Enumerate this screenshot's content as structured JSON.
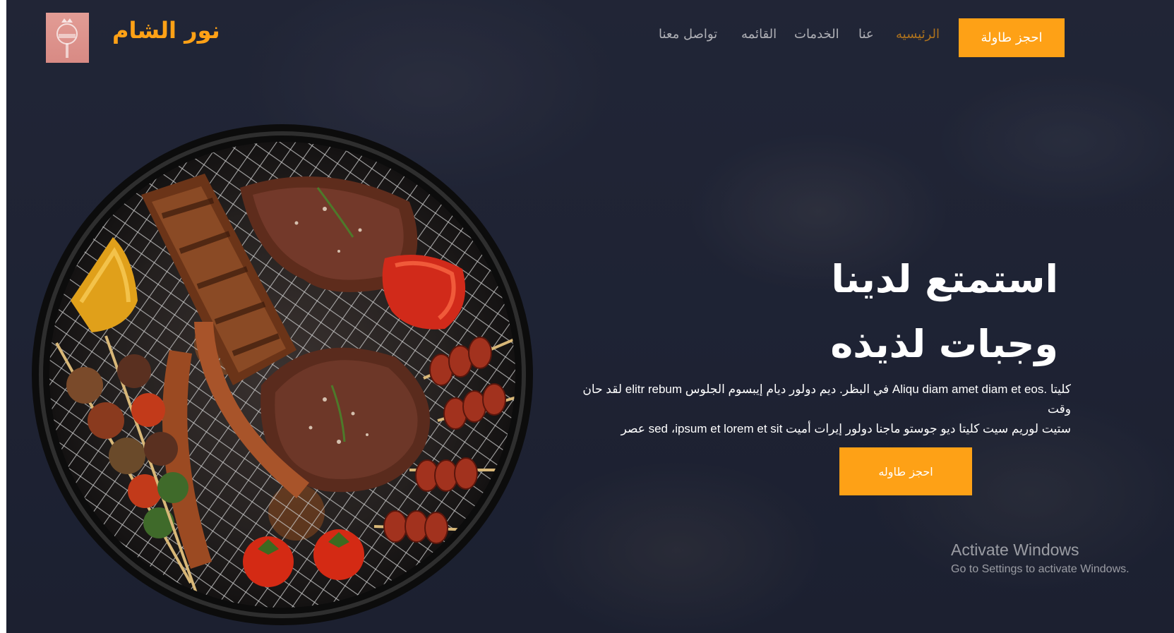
{
  "colors": {
    "accent": "#fea116",
    "background": "#232839",
    "text": "#ffffff"
  },
  "navbar": {
    "brand": "نور الشام",
    "logo_icon": "restaurant-logo-icon",
    "links": [
      {
        "label": "الرئيسيه",
        "active": true
      },
      {
        "label": "عنا",
        "active": false
      },
      {
        "label": "الخدمات",
        "active": false
      },
      {
        "label": "القائمه",
        "active": false
      },
      {
        "label": "تواصل معنا",
        "active": false
      }
    ],
    "book_button": "احجز طاولة"
  },
  "hero": {
    "title_line1": "استمتع لدينا",
    "title_line2": "وجبات لذيذه",
    "text_line1": "كليتا .Aliqu diam amet diam et eos في البظر. ديم دولور ديام إيبسوم الجلوس elitr rebum لقد حان وقت",
    "text_line2": "ستيت لوريم سيت كليتا ديو جوستو ماجنا دولور إيرات أميت sed ،ipsum et lorem et sit عصر",
    "button": "احجز طاوله",
    "image_icon": "grill-food-image"
  },
  "watermark": {
    "title": "Activate Windows",
    "subtitle": "Go to Settings to activate Windows."
  }
}
